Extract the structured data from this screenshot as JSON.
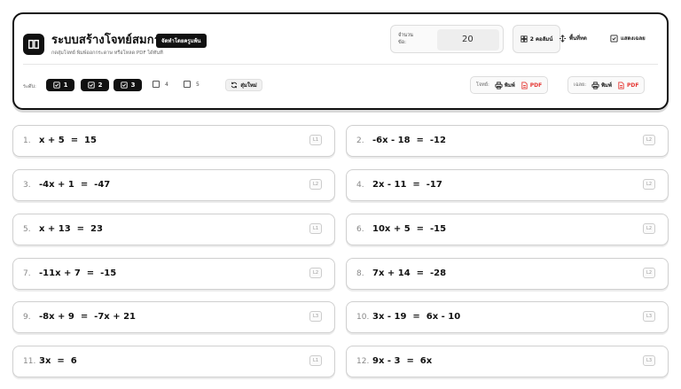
{
  "app": {
    "title": "ระบบสร้างโจทย์สมการ",
    "badge": "จัดทำโดยครูแพ้น",
    "subtitle": "กดสุ่มโจทย์ พิมพ์ออกกระดาษ หรือโหลด PDF ได้ทันที"
  },
  "settings": {
    "count_label": "จำนวนข้อ:",
    "count_value": "20",
    "columns_label": "2 คอลัมน์",
    "spacing_label": "พื้นที่ทด",
    "answers_label": "แสดงเฉลย"
  },
  "levels": {
    "label": "ระดับ:",
    "items": [
      {
        "label": "1",
        "checked": true
      },
      {
        "label": "2",
        "checked": true
      },
      {
        "label": "3",
        "checked": true
      },
      {
        "label": "4",
        "checked": false
      },
      {
        "label": "5",
        "checked": false
      }
    ],
    "shuffle_label": "สุ่มใหม่"
  },
  "print": {
    "problems": {
      "label": "โจทย์:",
      "print_label": "พิมพ์",
      "pdf_label": "PDF"
    },
    "answers": {
      "label": "เฉลย:",
      "print_label": "พิมพ์",
      "pdf_label": "PDF"
    }
  },
  "problems": [
    {
      "num": "1.",
      "equation": "x + 5  =  15",
      "level": "L1"
    },
    {
      "num": "2.",
      "equation": "-6x - 18  =  -12",
      "level": "L2"
    },
    {
      "num": "3.",
      "equation": "-4x + 1  =  -47",
      "level": "L2"
    },
    {
      "num": "4.",
      "equation": "2x - 11  =  -17",
      "level": "L2"
    },
    {
      "num": "5.",
      "equation": "x + 13  =  23",
      "level": "L1"
    },
    {
      "num": "6.",
      "equation": "10x + 5  =  -15",
      "level": "L2"
    },
    {
      "num": "7.",
      "equation": "-11x + 7  =  -15",
      "level": "L2"
    },
    {
      "num": "8.",
      "equation": "7x + 14  =  -28",
      "level": "L2"
    },
    {
      "num": "9.",
      "equation": "-8x + 9  =  -7x + 21",
      "level": "L3"
    },
    {
      "num": "10.",
      "equation": "3x - 19  =  6x - 10",
      "level": "L3"
    },
    {
      "num": "11.",
      "equation": "3x  =  6",
      "level": "L1"
    },
    {
      "num": "12.",
      "equation": "9x - 3  =  6x",
      "level": "L3"
    }
  ],
  "colors": {
    "accent": "#111111",
    "pdf": "#e53935"
  }
}
